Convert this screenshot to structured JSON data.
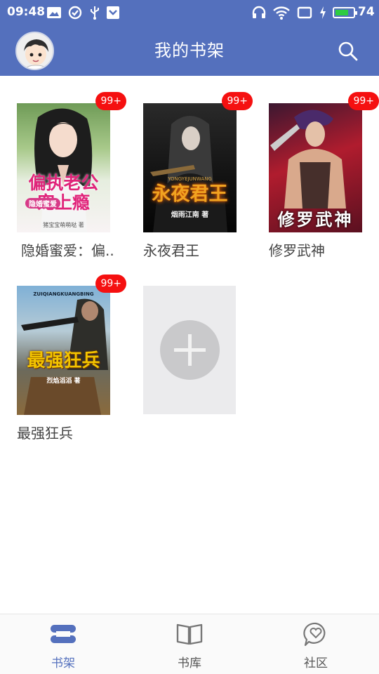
{
  "status_bar": {
    "time": "09:48",
    "battery_level": "74",
    "battery_fraction": 0.74,
    "icons_left": [
      "image-icon",
      "check-circle-icon",
      "usb-icon",
      "shield-download-icon"
    ],
    "icons_right": [
      "headset-icon",
      "wifi-icon",
      "rotate-icon",
      "charging-icon",
      "battery-icon"
    ]
  },
  "header": {
    "title": "我的书架",
    "avatar": "avatar",
    "search_icon": "search-icon"
  },
  "shelf": {
    "books": [
      {
        "title": "隐婚蜜爱：偏..",
        "badge": "99+",
        "cover_title": "偏执老公宠上瘾",
        "cover_sub": "隐婚蜜爱",
        "cover_author": "猪宝宝萌萌哒 著"
      },
      {
        "title": "永夜君王",
        "badge": "99+",
        "cover_title": "永夜君王",
        "cover_sub": "YONGYEJUNWANG",
        "cover_author": "烟雨江南 著"
      },
      {
        "title": "修罗武神",
        "badge": "99+",
        "cover_title": "修罗武神"
      },
      {
        "title": "最强狂兵",
        "badge": "99+",
        "cover_title": "最强狂兵",
        "cover_sub": "ZUIQIANGKUANGBING",
        "cover_author": "烈焰滔滔 著"
      }
    ],
    "add_icon": "plus-icon"
  },
  "nav": {
    "items": [
      {
        "label": "书架",
        "icon": "bookshelf-icon",
        "active": true
      },
      {
        "label": "书库",
        "icon": "open-book-icon",
        "active": false
      },
      {
        "label": "社区",
        "icon": "heart-chat-icon",
        "active": false
      }
    ]
  },
  "colors": {
    "primary": "#5470bd",
    "badge": "#f51010",
    "battery": "#2ecc40"
  }
}
